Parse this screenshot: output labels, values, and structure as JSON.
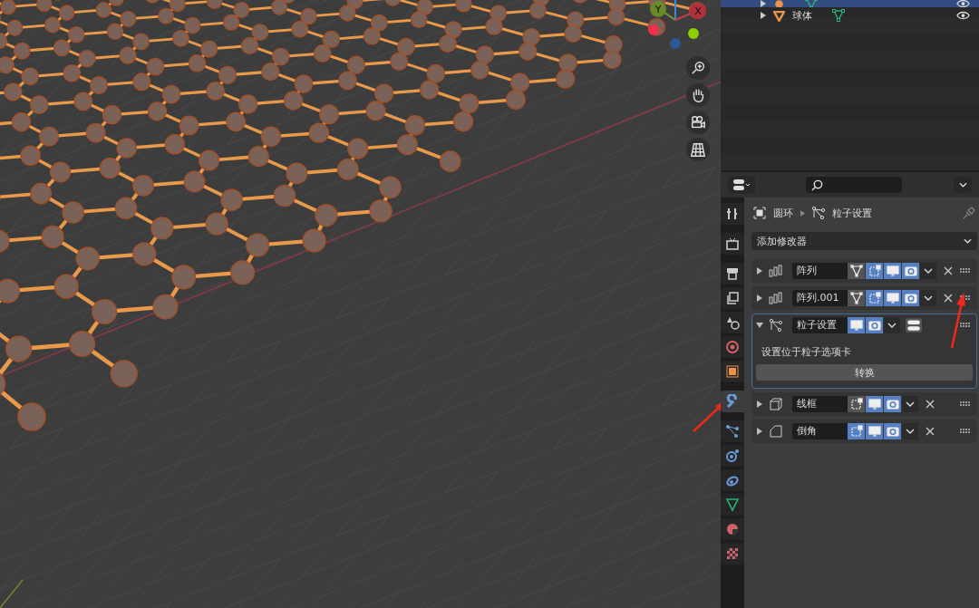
{
  "viewport": {
    "gizmo": {
      "x_label": "X",
      "y_label": "Y"
    },
    "nav_buttons": [
      {
        "kind": "zoom"
      },
      {
        "kind": "pan"
      },
      {
        "kind": "camera"
      },
      {
        "kind": "ortho"
      }
    ]
  },
  "outliner": {
    "rows": [
      {
        "label": "",
        "selected": true,
        "kind": "torus"
      },
      {
        "label": "球体",
        "selected": false,
        "kind": "sphere"
      }
    ]
  },
  "properties": {
    "tabs": [
      {
        "kind": "tool",
        "selected": false
      },
      {
        "kind": "render",
        "selected": false
      },
      {
        "kind": "output",
        "selected": false
      },
      {
        "kind": "view_layer",
        "selected": false
      },
      {
        "kind": "scene",
        "selected": false
      },
      {
        "kind": "world",
        "selected": false
      },
      {
        "kind": "object",
        "selected": false
      },
      {
        "kind": "modifier",
        "selected": true
      },
      {
        "kind": "particles",
        "selected": false
      },
      {
        "kind": "physics",
        "selected": false
      },
      {
        "kind": "constraints",
        "selected": false
      },
      {
        "kind": "data",
        "selected": false
      },
      {
        "kind": "material",
        "selected": false
      },
      {
        "kind": "texture",
        "selected": false
      }
    ],
    "breadcrumb": {
      "object": "圆环",
      "modifier": "粒子设置"
    },
    "add_modifier": "添加修改器",
    "modifiers": [
      {
        "kind": "array",
        "name": "阵列",
        "expanded": false,
        "toggles": [
          {
            "kind": "cage",
            "on": false
          },
          {
            "kind": "editmode",
            "on": true
          },
          {
            "kind": "viewport",
            "on": true
          },
          {
            "kind": "render",
            "on": true
          }
        ]
      },
      {
        "kind": "array",
        "name": "阵列.001",
        "expanded": false,
        "toggles": [
          {
            "kind": "cage",
            "on": false
          },
          {
            "kind": "editmode",
            "on": true
          },
          {
            "kind": "viewport",
            "on": true
          },
          {
            "kind": "render",
            "on": true
          }
        ]
      },
      {
        "kind": "particles",
        "name": "粒子设置",
        "expanded": true,
        "toggles": [
          {
            "kind": "viewport",
            "on": true
          },
          {
            "kind": "render",
            "on": true
          }
        ],
        "note": "设置位于粒子选项卡",
        "button": "转换"
      },
      {
        "kind": "wireframe",
        "name": "线框",
        "expanded": false,
        "toggles": [
          {
            "kind": "editmode",
            "on": false
          },
          {
            "kind": "viewport",
            "on": true
          },
          {
            "kind": "render",
            "on": true
          }
        ]
      },
      {
        "kind": "bevel",
        "name": "倒角",
        "expanded": false,
        "toggles": [
          {
            "kind": "editmode",
            "on": true
          },
          {
            "kind": "viewport",
            "on": true
          },
          {
            "kind": "render",
            "on": true
          }
        ]
      }
    ]
  }
}
